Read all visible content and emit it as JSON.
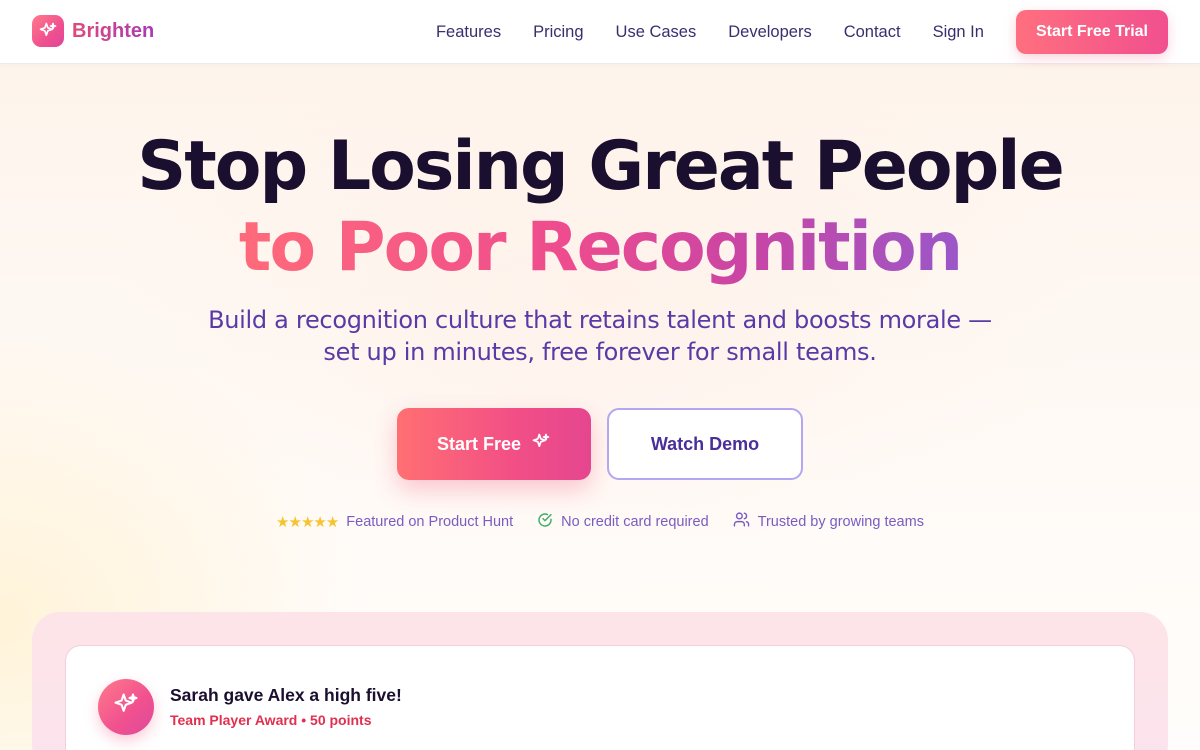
{
  "brand": {
    "name": "Brighten"
  },
  "nav": {
    "links": [
      "Features",
      "Pricing",
      "Use Cases",
      "Developers",
      "Contact",
      "Sign In"
    ],
    "cta": "Start Free Trial"
  },
  "hero": {
    "title_line1": "Stop Losing Great People",
    "title_line2": "to Poor Recognition",
    "subtitle": "Build a recognition culture that retains talent and boosts morale — set up in minutes, free forever for small teams.",
    "primary_cta": "Start Free",
    "secondary_cta": "Watch Demo"
  },
  "trust": {
    "rating_stars": 5,
    "product_hunt": "Featured on Product Hunt",
    "no_card": "No credit card required",
    "teams": "Trusted by growing teams"
  },
  "activity": {
    "title": "Sarah gave Alex a high five!",
    "meta": "Team Player Award • 50 points"
  },
  "colors": {
    "brand_pink": "#f0508f",
    "brand_coral": "#ff6f7f",
    "purple_text": "#5a3aa6",
    "dark_text": "#1a0f2e",
    "star_gold": "#f6c431",
    "award_red": "#e0304f"
  }
}
